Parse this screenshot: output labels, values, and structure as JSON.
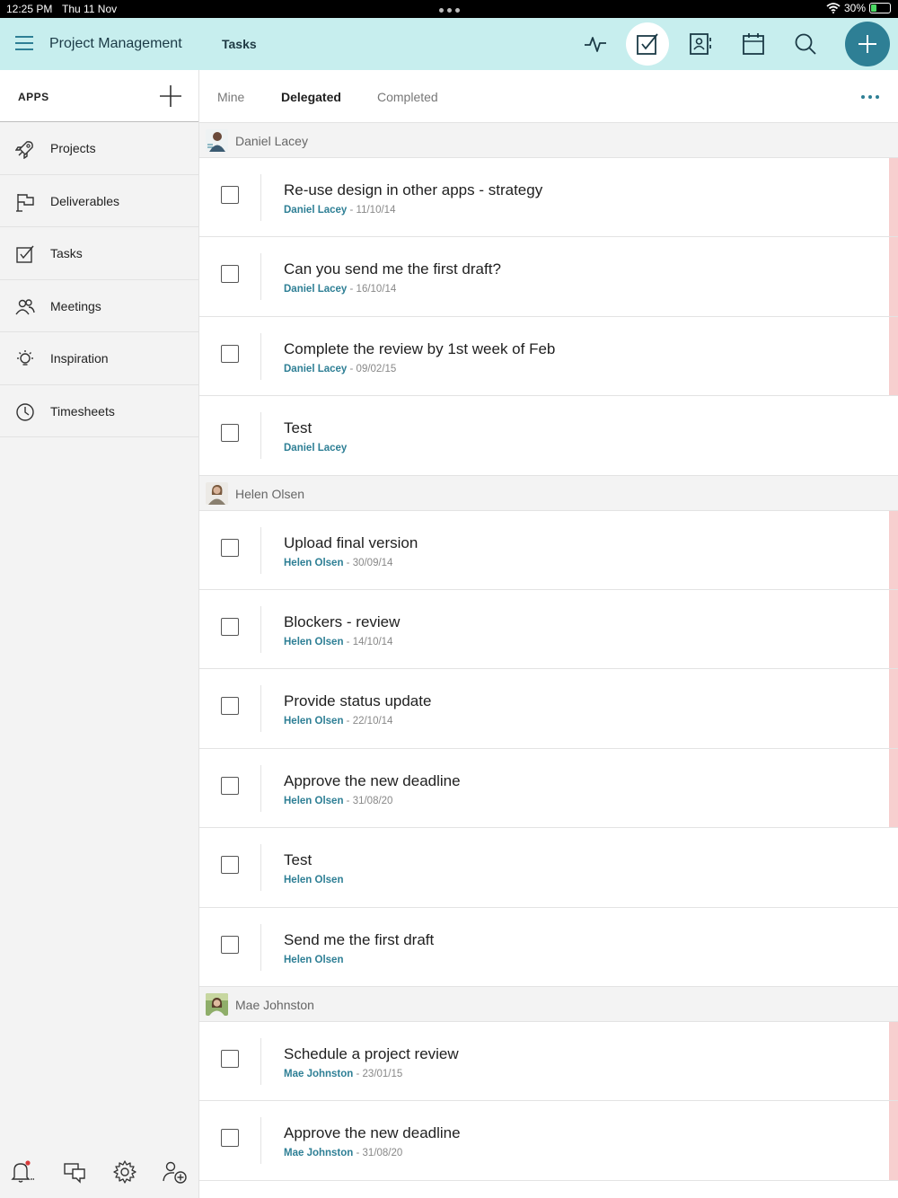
{
  "status_bar": {
    "time": "12:25 PM",
    "date": "Thu 11 Nov",
    "battery": "30%",
    "battery_level": 0.3
  },
  "header": {
    "app_title": "Project Management",
    "page_title": "Tasks",
    "icons": [
      "activity-icon",
      "tasks-icon",
      "contacts-icon",
      "calendar-icon",
      "search-icon",
      "add-icon"
    ],
    "accent_color": "#2e7f95",
    "background_color": "#c7eeee"
  },
  "sidebar": {
    "apps_label": "APPS",
    "items": [
      {
        "label": "Projects",
        "icon": "rocket-icon"
      },
      {
        "label": "Deliverables",
        "icon": "flag-icon"
      },
      {
        "label": "Tasks",
        "icon": "checkbox-icon"
      },
      {
        "label": "Meetings",
        "icon": "people-icon"
      },
      {
        "label": "Inspiration",
        "icon": "lightbulb-icon"
      },
      {
        "label": "Timesheets",
        "icon": "clock-icon"
      }
    ],
    "footer_icons": [
      "bell-icon",
      "chat-icon",
      "settings-icon",
      "add-person-icon"
    ]
  },
  "tabs": {
    "items": [
      "Mine",
      "Delegated",
      "Completed"
    ],
    "active": "Delegated"
  },
  "groups": [
    {
      "name": "Daniel Lacey",
      "tasks": [
        {
          "title": "Re-use design in other apps - strategy",
          "who": "Daniel Lacey",
          "date": " - 11/10/14",
          "overdue": true
        },
        {
          "title": "Can you send me the first draft?",
          "who": "Daniel Lacey",
          "date": " - 16/10/14",
          "overdue": true
        },
        {
          "title": "Complete the review by 1st week of Feb",
          "who": "Daniel Lacey",
          "date": " - 09/02/15",
          "overdue": true
        },
        {
          "title": "Test",
          "who": "Daniel Lacey",
          "date": "",
          "overdue": false
        }
      ]
    },
    {
      "name": "Helen Olsen",
      "tasks": [
        {
          "title": "Upload final version",
          "who": "Helen Olsen",
          "date": " - 30/09/14",
          "overdue": true
        },
        {
          "title": "Blockers - review",
          "who": "Helen Olsen",
          "date": " - 14/10/14",
          "overdue": true
        },
        {
          "title": "Provide status update",
          "who": "Helen Olsen",
          "date": " - 22/10/14",
          "overdue": true
        },
        {
          "title": "Approve the new deadline",
          "who": "Helen Olsen",
          "date": " - 31/08/20",
          "overdue": true
        },
        {
          "title": "Test",
          "who": "Helen Olsen",
          "date": "",
          "overdue": false
        },
        {
          "title": "Send me the first draft",
          "who": "Helen Olsen",
          "date": "",
          "overdue": false
        }
      ]
    },
    {
      "name": "Mae Johnston",
      "tasks": [
        {
          "title": "Schedule a project review",
          "who": "Mae Johnston",
          "date": " - 23/01/15",
          "overdue": true
        },
        {
          "title": "Approve the new deadline",
          "who": "Mae Johnston",
          "date": " - 31/08/20",
          "overdue": true
        }
      ]
    }
  ]
}
